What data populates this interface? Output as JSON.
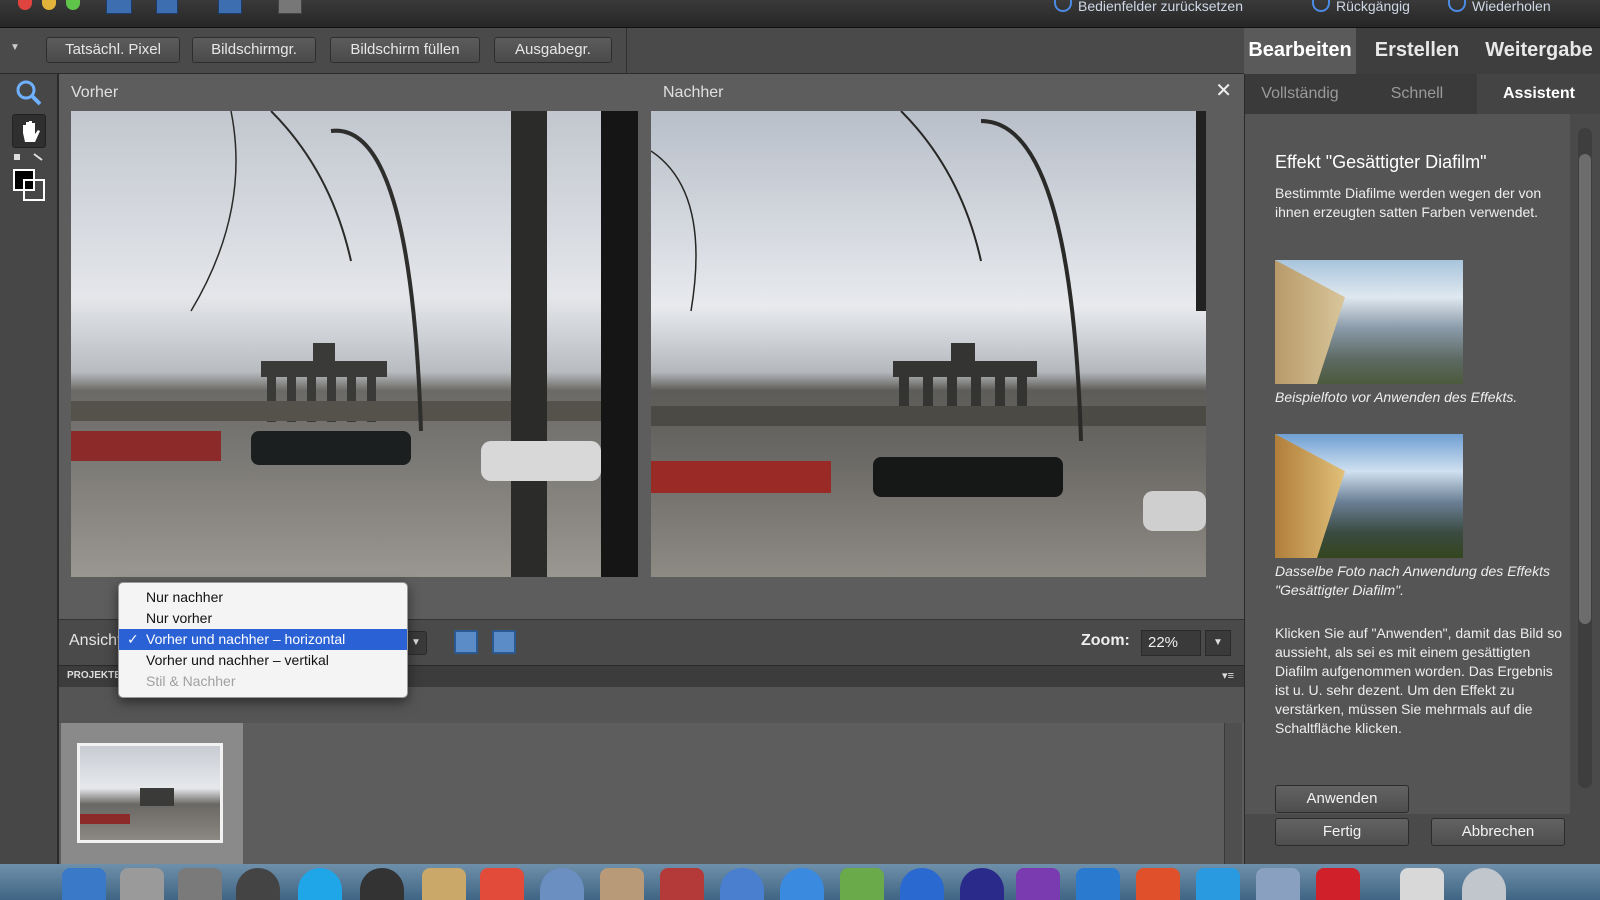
{
  "titlebar": {
    "reset_panels": "Bedienfelder zurücksetzen",
    "undo": "Rückgängig",
    "redo": "Wiederholen"
  },
  "optionsbar": {
    "buttons": [
      "Tatsächl. Pixel",
      "Bildschirmgr.",
      "Bildschirm füllen",
      "Ausgabegr."
    ]
  },
  "modetabs": [
    "Bearbeiten",
    "Erstellen",
    "Weitergabe"
  ],
  "preview": {
    "before_label": "Vorher",
    "after_label": "Nachher",
    "close": "✕"
  },
  "viewbar": {
    "view_label": "Ansicht:",
    "zoom_label": "Zoom:",
    "zoom_value": "22%"
  },
  "view_menu": {
    "items": [
      {
        "label": "Nur nachher"
      },
      {
        "label": "Nur vorher"
      },
      {
        "label": "Vorher und nachher – horizontal",
        "checked": "✓"
      },
      {
        "label": "Vorher und nachher – vertikal"
      },
      {
        "label": "Stil & Nachher"
      }
    ]
  },
  "bin": {
    "title": "PROJEKTBEREICH"
  },
  "rightpanel": {
    "subtabs": [
      "Vollständig",
      "Schnell",
      "Assistent"
    ],
    "title": "Effekt \"Gesättigter Diafilm\"",
    "intro": "Bestimmte Diafilme werden wegen der von ihnen erzeugten satten Farben verwendet.",
    "caption_before": "Beispielfoto vor Anwenden des Effekts.",
    "caption_after": "Dasselbe Foto nach Anwendung des Effekts \"Gesättigter Diafilm\".",
    "instructions": "Klicken Sie auf \"Anwenden\", damit das Bild so aussieht, als sei es mit einem gesättigten Diafilm aufgenommen worden. Das Ergebnis ist u. U. sehr dezent. Um den Effekt zu verstärken, müssen Sie mehrmals auf die Schaltfläche klicken.",
    "apply": "Anwenden",
    "done": "Fertig",
    "cancel": "Abbrechen"
  },
  "colors": {
    "accent": "#2a62d6",
    "panel": "#4a4a4a",
    "preview_bg": "#5d5d5d"
  },
  "icons": [
    "zoom-icon",
    "hand-icon",
    "color-swatch-icon",
    "close-icon",
    "chevron-down-icon"
  ]
}
